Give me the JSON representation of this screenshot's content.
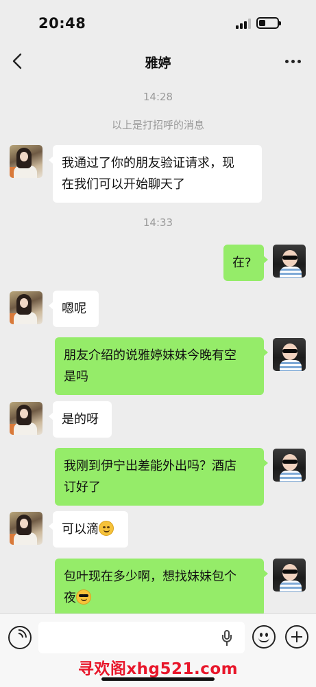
{
  "status_bar": {
    "time": "20:48"
  },
  "header": {
    "title": "雅婷"
  },
  "timestamps": [
    "14:28",
    "14:33"
  ],
  "system_message": "以上是打招呼的消息",
  "messages": [
    {
      "side": "in",
      "lines": [
        "我通过了你的朋友验证请求，现",
        "在我们可以开始聊天了"
      ]
    },
    {
      "side": "out",
      "lines": [
        "在?"
      ]
    },
    {
      "side": "in",
      "lines": [
        "嗯呢"
      ]
    },
    {
      "side": "out",
      "lines": [
        "朋友介绍的说雅婷妹妹今晚有空",
        "是吗"
      ]
    },
    {
      "side": "in",
      "lines": [
        "是的呀"
      ]
    },
    {
      "side": "out",
      "lines": [
        "我刚到伊宁出差能外出吗？酒店",
        "订好了"
      ]
    },
    {
      "side": "in",
      "lines": [
        "可以滴"
      ],
      "emoji": "smile-emoji"
    },
    {
      "side": "out",
      "lines": [
        "包叶现在多少啊，想找妹妹包个",
        "夜"
      ],
      "emoji": "sunglasses-emoji"
    }
  ],
  "input": {
    "value": "",
    "placeholder": ""
  },
  "icons": {
    "back": "chevron-left-icon",
    "more": "more-dots-icon",
    "voice": "voice-mode-icon",
    "mic": "microphone-icon",
    "emoji": "emoji-icon",
    "plus": "plus-icon"
  },
  "colors": {
    "background": "#ededed",
    "incoming": "#ffffff",
    "outgoing": "#95ec69",
    "watermark": "#e8162a"
  },
  "watermark": "寻欢阁xhg521.com"
}
